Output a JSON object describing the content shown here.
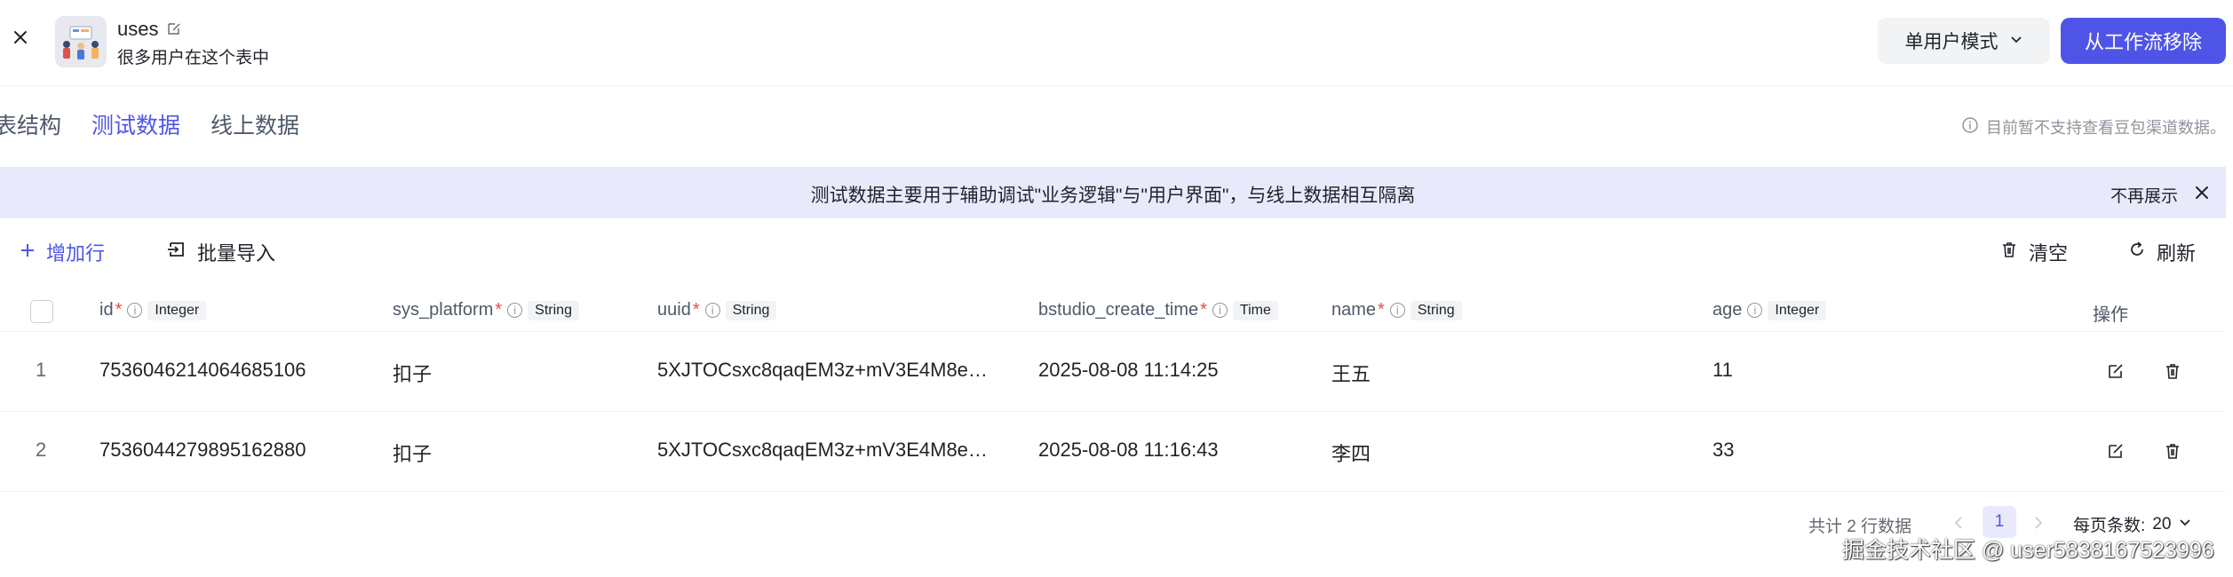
{
  "header": {
    "title": "uses",
    "subtitle": "很多用户在这个表中",
    "mode_label": "单用户模式",
    "remove_label": "从工作流移除"
  },
  "tabs": [
    {
      "label": "表结构",
      "active": false
    },
    {
      "label": "测试数据",
      "active": true
    },
    {
      "label": "线上数据",
      "active": false
    }
  ],
  "notice_right": "目前暂不支持查看豆包渠道数据。",
  "banner": {
    "text": "测试数据主要用于辅助调试\"业务逻辑\"与\"用户界面\"，与线上数据相互隔离",
    "dismiss_label": "不再展示"
  },
  "toolbar": {
    "add_label": "增加行",
    "import_label": "批量导入",
    "clear_label": "清空",
    "refresh_label": "刷新"
  },
  "table": {
    "columns": [
      {
        "name": "id",
        "required": true,
        "type": "Integer"
      },
      {
        "name": "sys_platform",
        "required": true,
        "type": "String"
      },
      {
        "name": "uuid",
        "required": true,
        "type": "String"
      },
      {
        "name": "bstudio_create_time",
        "required": true,
        "type": "Time"
      },
      {
        "name": "name",
        "required": true,
        "type": "String"
      },
      {
        "name": "age",
        "required": false,
        "type": "Integer"
      }
    ],
    "actions_header": "操作",
    "rows": [
      {
        "index": "1",
        "id": "7536046214064685106",
        "sys_platform": "扣子",
        "uuid": "5XJTOCsxc8qaqEM3z+mV3E4M8e…",
        "create_time": "2025-08-08 11:14:25",
        "name": "王五",
        "age": "11"
      },
      {
        "index": "2",
        "id": "7536044279895162880",
        "sys_platform": "扣子",
        "uuid": "5XJTOCsxc8qaqEM3z+mV3E4M8e…",
        "create_time": "2025-08-08 11:16:43",
        "name": "李四",
        "age": "33"
      }
    ]
  },
  "footer": {
    "total_text": "共计 2 行数据",
    "current_page": "1",
    "page_size_label": "每页条数:",
    "page_size_value": "20"
  },
  "watermark": "掘金技术社区 @ user5838167523996",
  "colors": {
    "accent": "#4e55e6",
    "banner_bg": "#e8eafc",
    "required": "#e5484d"
  }
}
